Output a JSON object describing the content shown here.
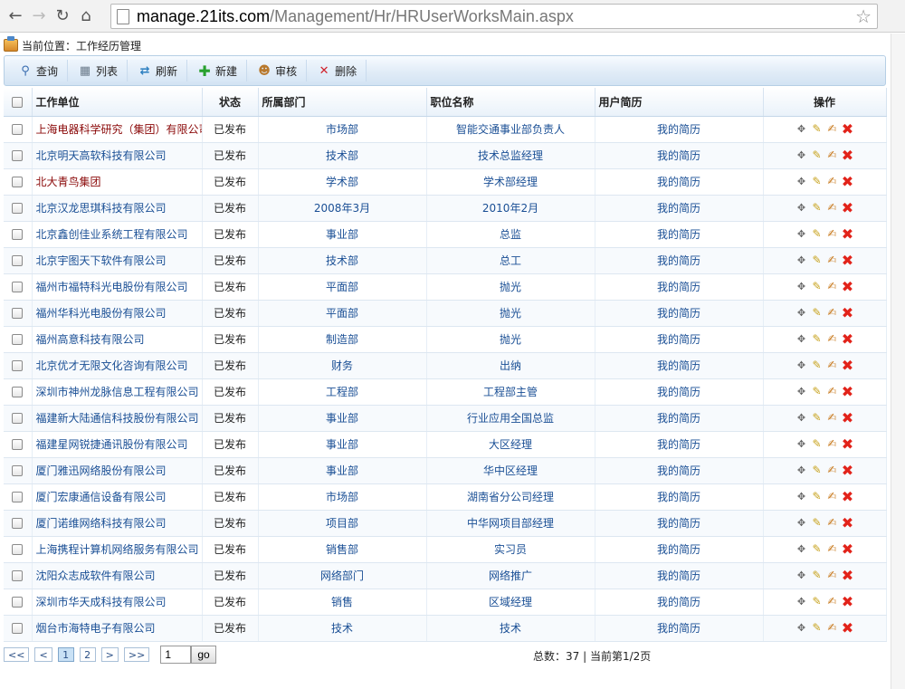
{
  "browser": {
    "url_host": "manage.21its.com",
    "url_path": "/Management/Hr/HRUserWorksMain.aspx"
  },
  "location": {
    "text": "当前位置：工作经历管理"
  },
  "toolbar": [
    {
      "label": "查询",
      "icon": "search-icon"
    },
    {
      "label": "列表",
      "icon": "list-icon"
    },
    {
      "label": "刷新",
      "icon": "refresh-icon"
    },
    {
      "label": "新建",
      "icon": "add-icon"
    },
    {
      "label": "审核",
      "icon": "audit-user-icon"
    },
    {
      "label": "删除",
      "icon": "delete-icon"
    }
  ],
  "table": {
    "headers": {
      "company": "工作单位",
      "status": "状态",
      "dept": "所属部门",
      "position": "职位名称",
      "resume": "用户简历",
      "ops": "操作"
    },
    "rows": [
      {
        "company": "上海电器科学研究（集团）有限公司",
        "status": "已发布",
        "dept": "市场部",
        "position": "智能交通事业部负责人",
        "resume": "我的简历",
        "company_color": "red"
      },
      {
        "company": "北京明天高软科技有限公司",
        "status": "已发布",
        "dept": "技术部",
        "position": "技术总监经理",
        "resume": "我的简历"
      },
      {
        "company": "北大青鸟集团",
        "status": "已发布",
        "dept": "学术部",
        "position": "学术部经理",
        "resume": "我的简历",
        "company_color": "red"
      },
      {
        "company": "北京汉龙思琪科技有限公司",
        "status": "已发布",
        "dept": "2008年3月",
        "position": "2010年2月",
        "resume": "我的简历"
      },
      {
        "company": "北京鑫创佳业系统工程有限公司",
        "status": "已发布",
        "dept": "事业部",
        "position": "总监",
        "resume": "我的简历"
      },
      {
        "company": "北京宇图天下软件有限公司",
        "status": "已发布",
        "dept": "技术部",
        "position": "总工",
        "resume": "我的简历"
      },
      {
        "company": "福州市福特科光电股份有限公司",
        "status": "已发布",
        "dept": "平面部",
        "position": "抛光",
        "resume": "我的简历"
      },
      {
        "company": "福州华科光电股份有限公司",
        "status": "已发布",
        "dept": "平面部",
        "position": "抛光",
        "resume": "我的简历"
      },
      {
        "company": "福州高意科技有限公司",
        "status": "已发布",
        "dept": "制造部",
        "position": "抛光",
        "resume": "我的简历"
      },
      {
        "company": "北京优才无限文化咨询有限公司",
        "status": "已发布",
        "dept": "财务",
        "position": "出纳",
        "resume": "我的简历"
      },
      {
        "company": "深圳市神州龙脉信息工程有限公司",
        "status": "已发布",
        "dept": "工程部",
        "position": "工程部主管",
        "resume": "我的简历"
      },
      {
        "company": "福建新大陆通信科技股份有限公司",
        "status": "已发布",
        "dept": "事业部",
        "position": "行业应用全国总监",
        "resume": "我的简历"
      },
      {
        "company": "福建星网锐捷通讯股份有限公司",
        "status": "已发布",
        "dept": "事业部",
        "position": "大区经理",
        "resume": "我的简历"
      },
      {
        "company": "厦门雅迅网络股份有限公司",
        "status": "已发布",
        "dept": "事业部",
        "position": "华中区经理",
        "resume": "我的简历"
      },
      {
        "company": "厦门宏康通信设备有限公司",
        "status": "已发布",
        "dept": "市场部",
        "position": "湖南省分公司经理",
        "resume": "我的简历"
      },
      {
        "company": "厦门诺维网络科技有限公司",
        "status": "已发布",
        "dept": "项目部",
        "position": "中华网项目部经理",
        "resume": "我的简历"
      },
      {
        "company": "上海携程计算机网络服务有限公司",
        "status": "已发布",
        "dept": "销售部",
        "position": "实习员",
        "resume": "我的简历"
      },
      {
        "company": "沈阳众志成软件有限公司",
        "status": "已发布",
        "dept": "网络部门",
        "position": "网络推广",
        "resume": "我的简历"
      },
      {
        "company": "深圳市华天成科技有限公司",
        "status": "已发布",
        "dept": "销售",
        "position": "区域经理",
        "resume": "我的简历"
      },
      {
        "company": "烟台市海特电子有限公司",
        "status": "已发布",
        "dept": "技术",
        "position": "技术",
        "resume": "我的简历"
      }
    ]
  },
  "pager": {
    "first": "<<",
    "prev": "<",
    "next": ">",
    "last": ">>",
    "pages": [
      "1",
      "2"
    ],
    "current_page": "1",
    "goto_value": "1",
    "go_label": "go",
    "info": "总数：37 | 当前第1/2页"
  }
}
